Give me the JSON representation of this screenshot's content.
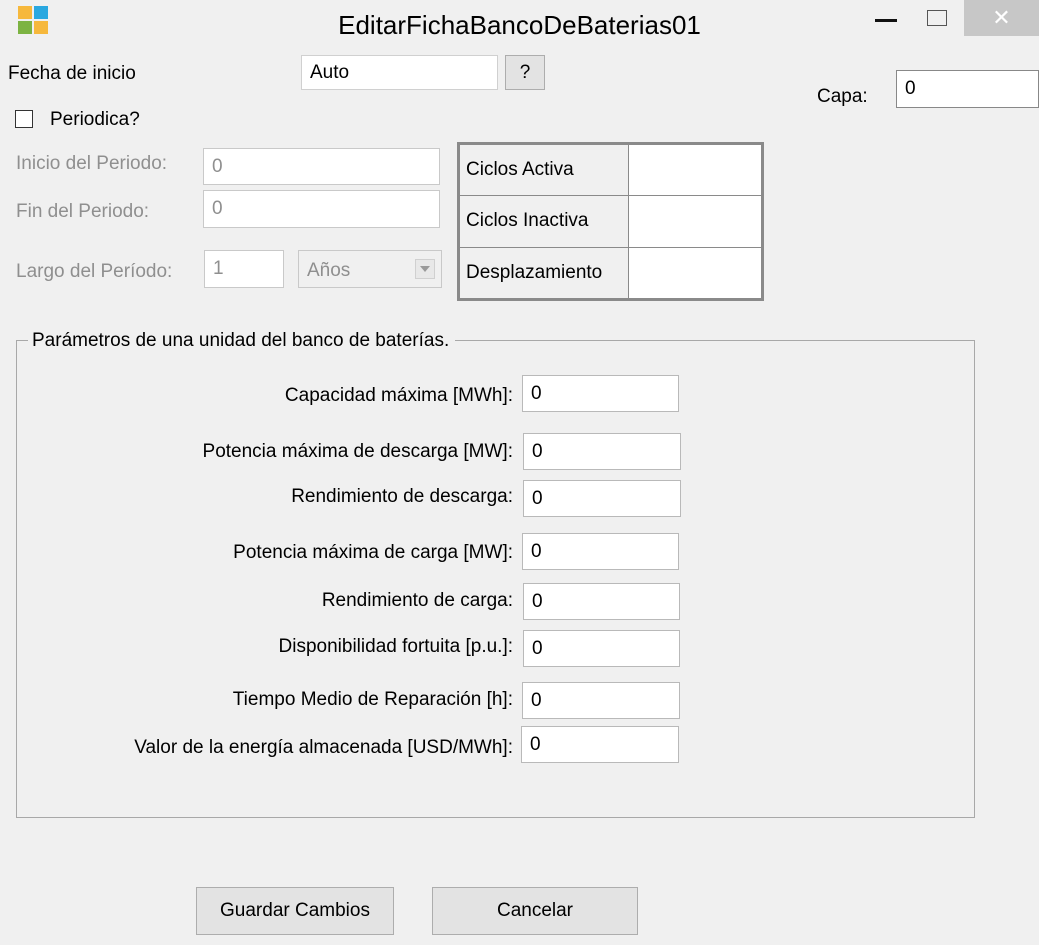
{
  "window": {
    "title": "EditarFichaBancoDeBaterias01",
    "controls": {
      "minimize": "–",
      "maximize": "☐",
      "close": "✕"
    }
  },
  "top": {
    "fecha_label": "Fecha de inicio",
    "fecha_value": "Auto",
    "help_button": "?",
    "capa_label": "Capa:",
    "capa_value": "0",
    "periodica_label": "Periodica?"
  },
  "periodo": {
    "inicio_label": "Inicio del Periodo:",
    "inicio_value": "0",
    "fin_label": "Fin del Periodo:",
    "fin_value": "0",
    "largo_label": "Largo del Período:",
    "largo_value": "1",
    "unit_value": "Años"
  },
  "ciclos": {
    "rows": [
      {
        "label": "Ciclos Activa",
        "value": ""
      },
      {
        "label": "Ciclos Inactiva",
        "value": ""
      },
      {
        "label": "Desplazamiento",
        "value": ""
      }
    ]
  },
  "params": {
    "legend": "Parámetros de una unidad del banco de baterías.",
    "fields": [
      {
        "label": "Capacidad máxima [MWh]:",
        "value": "0"
      },
      {
        "label": "Potencia máxima de descarga [MW]:",
        "value": "0"
      },
      {
        "label": "Rendimiento de descarga:",
        "value": "0"
      },
      {
        "label": "Potencia máxima de carga [MW]:",
        "value": "0"
      },
      {
        "label": "Rendimiento de carga:",
        "value": "0"
      },
      {
        "label": "Disponibilidad fortuita [p.u.]:",
        "value": "0"
      },
      {
        "label": "Tiempo Medio de Reparación [h]:",
        "value": "0"
      },
      {
        "label": "Valor de la energía almacenada [USD/MWh]:",
        "value": "0"
      }
    ]
  },
  "buttons": {
    "save": "Guardar Cambios",
    "cancel": "Cancelar"
  }
}
